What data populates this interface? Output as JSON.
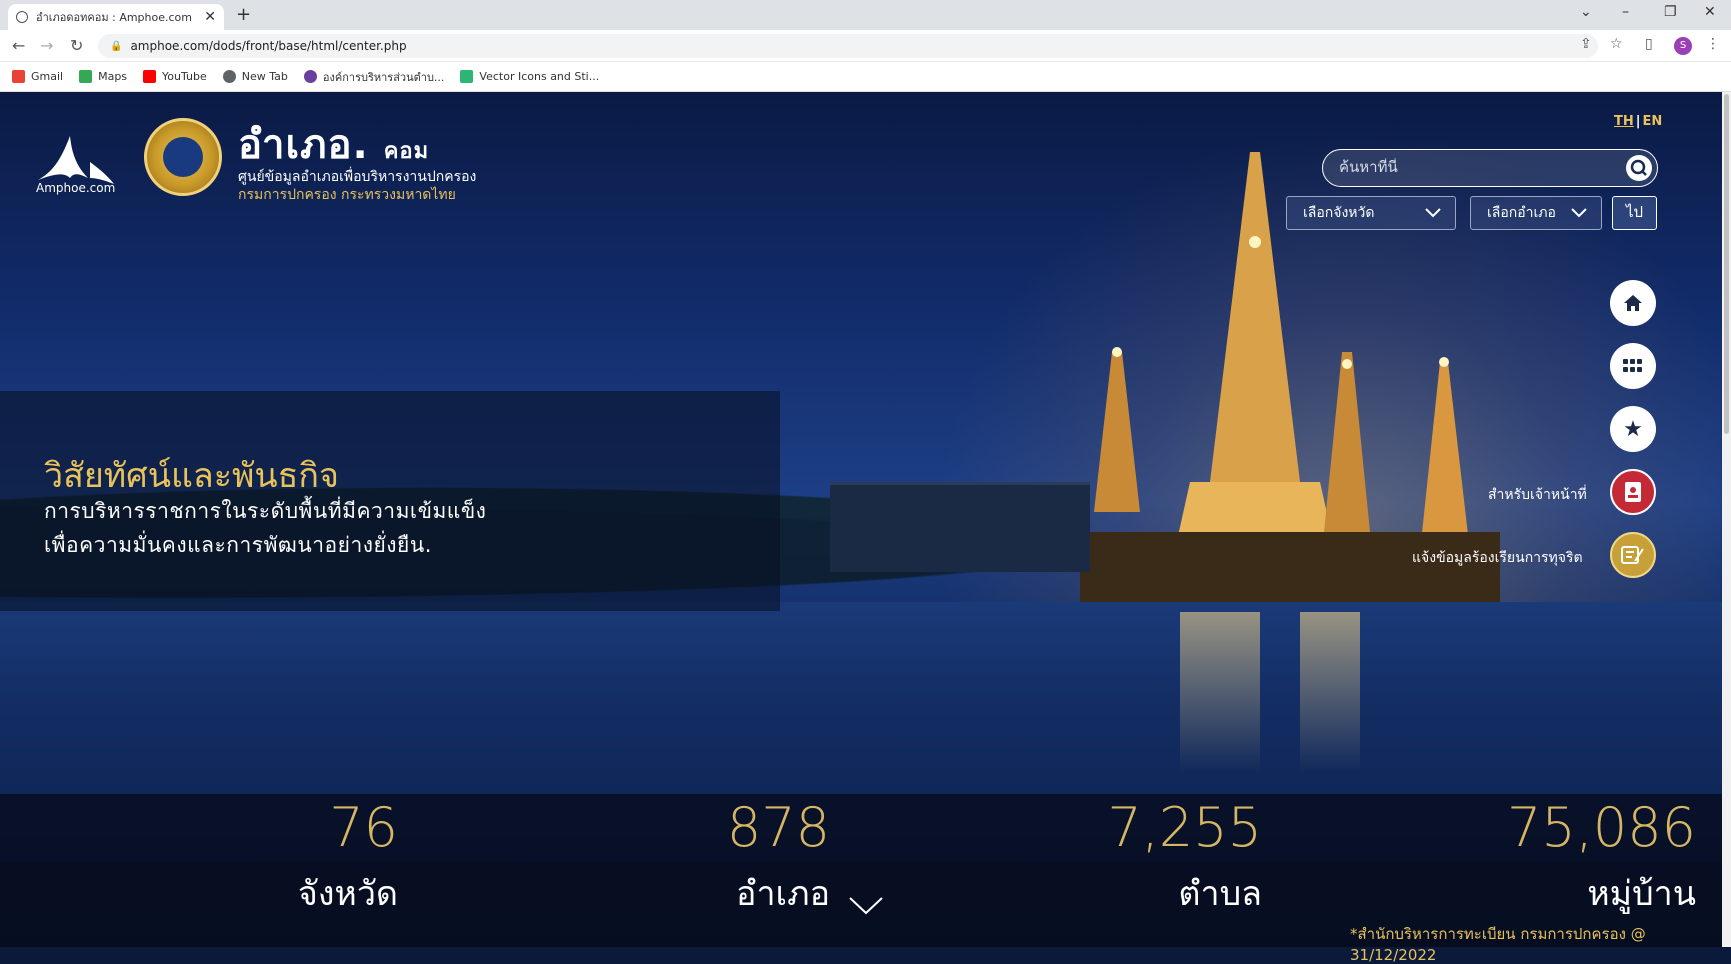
{
  "browser": {
    "tab_title": "อำเภอดอทคอม : Amphoe.com",
    "tab_close": "✕",
    "new_tab": "+",
    "url": "amphoe.com/dods/front/base/html/center.php",
    "profile_initial": "S",
    "bookmarks": [
      {
        "label": "Gmail",
        "color": "#ea4335"
      },
      {
        "label": "Maps",
        "color": "#34a853"
      },
      {
        "label": "YouTube",
        "color": "#ff0000"
      },
      {
        "label": "New Tab",
        "color": "#5f6368"
      },
      {
        "label": "องค์การบริหารส่วนตำบ...",
        "color": "#6a3fa0"
      },
      {
        "label": "Vector Icons and Sti...",
        "color": "#2bb673"
      }
    ]
  },
  "site": {
    "logo_text": "Amphoe.com",
    "title_main": "อำเภอ.",
    "title_sub": "คอม",
    "subtitle_1": "ศูนย์ข้อมูลอำเภอเพื่อบริหารงานปกครอง",
    "subtitle_2": "กรมการปกครอง กระทรวงมหาดไทย"
  },
  "lang": {
    "th": "TH",
    "sep": "|",
    "en": "EN"
  },
  "search": {
    "placeholder": "ค้นหาที่นี่"
  },
  "filters": {
    "province": "เลือกจังหวัด",
    "district": "เลือกอำเภอ",
    "go": "ไป"
  },
  "side_menu": {
    "officer_label": "สำหรับเจ้าหน้าที่",
    "complaint_label": "แจ้งข้อมูลร้องเรียนการทุจริต"
  },
  "vision": {
    "title": "วิสัยทัศน์และพันธกิจ",
    "line1": "การบริหารราชการในระดับพื้นที่มีความเข้มแข็ง",
    "line2": "เพื่อความมั่นคงและการพัฒนาอย่างยั่งยืน."
  },
  "stats": [
    {
      "value": "76",
      "label": "จังหวัด"
    },
    {
      "value": "878",
      "label": "อำเภอ"
    },
    {
      "value": "7,255",
      "label": "ตำบล"
    },
    {
      "value": "75,086",
      "label": "หมู่บ้าน"
    }
  ],
  "stats_note": "*สำนักบริหารการทะเบียน กรมการปกครอง @ 31/12/2022",
  "colors": {
    "accent_gold": "#e8c25a",
    "stat_gold": "#d4b664",
    "officer_red": "#c42a36"
  }
}
